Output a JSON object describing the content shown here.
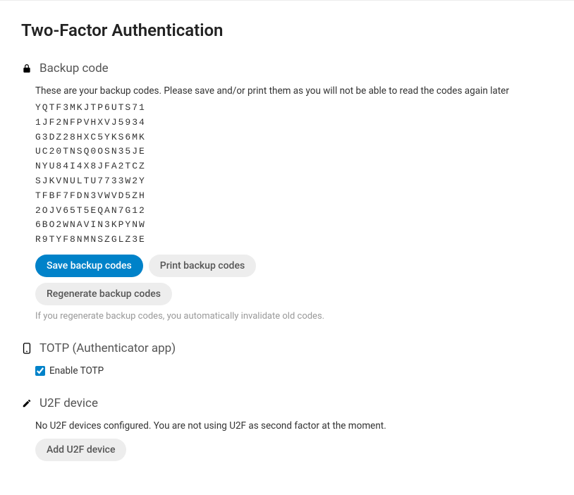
{
  "page": {
    "title": "Two-Factor Authentication"
  },
  "backup": {
    "heading": "Backup code",
    "description": "These are your backup codes. Please save and/or print them as you will not be able to read the codes again later",
    "codes": [
      "YQTF3MKJTP6UTS71",
      "1JF2NFPVHXVJ5934",
      "G3DZ28HXC5YKS6MK",
      "UC20TNSQ0OSN35JE",
      "NYU84I4X8JFA2TCZ",
      "SJKVNULTU7733W2Y",
      "TFBF7FDN3VWVD5ZH",
      "2OJV65T5EQAN7G12",
      "6BO2WNAVIN3KPYNW",
      "R9TYF8NMNSZGLZ3E"
    ],
    "save_button": "Save backup codes",
    "print_button": "Print backup codes",
    "regenerate_button": "Regenerate backup codes",
    "regenerate_hint": "If you regenerate backup codes, you automatically invalidate old codes."
  },
  "totp": {
    "heading": "TOTP (Authenticator app)",
    "enable_label": "Enable TOTP",
    "enabled": true
  },
  "u2f": {
    "heading": "U2F device",
    "description": "No U2F devices configured. You are not using U2F as second factor at the moment.",
    "add_button": "Add U2F device"
  }
}
